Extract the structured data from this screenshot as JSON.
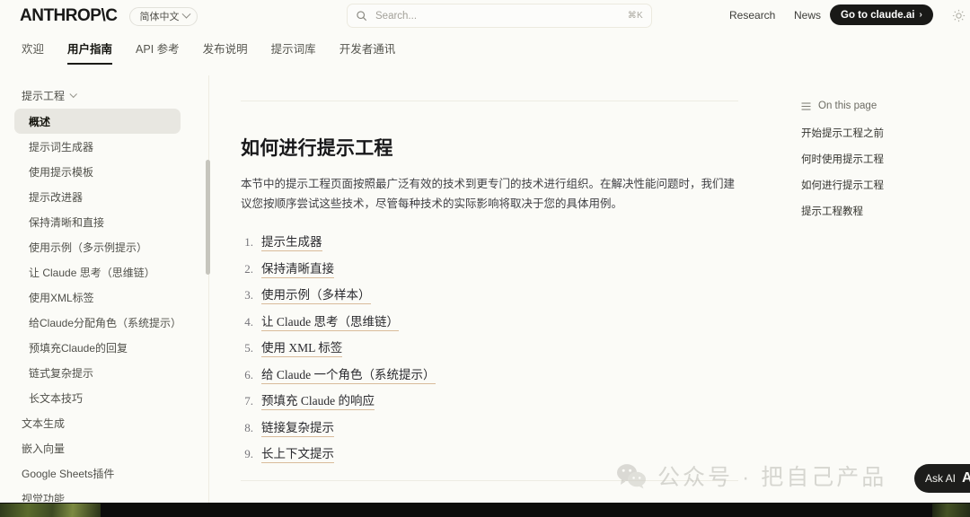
{
  "header": {
    "logo": "ANTHROP\\C",
    "language_selector": "简体中文",
    "search": {
      "placeholder": "Search...",
      "shortcut": "⌘K"
    },
    "links": [
      {
        "label": "Research"
      },
      {
        "label": "News"
      }
    ],
    "cta": {
      "label": "Go to claude.ai",
      "arrow": "›"
    }
  },
  "tabs": [
    {
      "label": "欢迎",
      "active": false
    },
    {
      "label": "用户指南",
      "active": true
    },
    {
      "label": "API 参考",
      "active": false
    },
    {
      "label": "发布说明",
      "active": false
    },
    {
      "label": "提示词库",
      "active": false
    },
    {
      "label": "开发者通讯",
      "active": false
    }
  ],
  "sidebar": {
    "group_label": "提示工程",
    "items": [
      {
        "label": "概述",
        "active": true,
        "level": "sub"
      },
      {
        "label": "提示词生成器",
        "active": false,
        "level": "sub"
      },
      {
        "label": "使用提示模板",
        "active": false,
        "level": "sub"
      },
      {
        "label": "提示改进器",
        "active": false,
        "level": "sub"
      },
      {
        "label": "保持清晰和直接",
        "active": false,
        "level": "sub"
      },
      {
        "label": "使用示例（多示例提示）",
        "active": false,
        "level": "sub"
      },
      {
        "label": "让 Claude 思考（思维链）",
        "active": false,
        "level": "sub"
      },
      {
        "label": "使用XML标签",
        "active": false,
        "level": "sub"
      },
      {
        "label": "给Claude分配角色（系统提示）",
        "active": false,
        "level": "sub"
      },
      {
        "label": "预填充Claude的回复",
        "active": false,
        "level": "sub"
      },
      {
        "label": "链式复杂提示",
        "active": false,
        "level": "sub"
      },
      {
        "label": "长文本技巧",
        "active": false,
        "level": "sub"
      },
      {
        "label": "文本生成",
        "active": false,
        "level": "top"
      },
      {
        "label": "嵌入向量",
        "active": false,
        "level": "top"
      },
      {
        "label": "Google Sheets插件",
        "active": false,
        "level": "top"
      },
      {
        "label": "视觉功能",
        "active": false,
        "level": "top"
      }
    ]
  },
  "main": {
    "heading": "如何进行提示工程",
    "paragraph": "本节中的提示工程页面按照最广泛有效的技术到更专门的技术进行组织。在解决性能问题时，我们建议您按顺序尝试这些技术，尽管每种技术的实际影响将取决于您的具体用例。",
    "list": [
      {
        "num": "1.",
        "label": "提示生成器"
      },
      {
        "num": "2.",
        "label": "保持清晰直接"
      },
      {
        "num": "3.",
        "label": "使用示例（多样本）"
      },
      {
        "num": "4.",
        "label": "让 Claude 思考（思维链）"
      },
      {
        "num": "5.",
        "label": "使用 XML 标签"
      },
      {
        "num": "6.",
        "label": "给 Claude 一个角色（系统提示）"
      },
      {
        "num": "7.",
        "label": "预填充 Claude 的响应"
      },
      {
        "num": "8.",
        "label": "链接复杂提示"
      },
      {
        "num": "9.",
        "label": "长上下文提示"
      }
    ]
  },
  "toc": {
    "title": "On this page",
    "links": [
      {
        "label": "开始提示工程之前"
      },
      {
        "label": "何时使用提示工程"
      },
      {
        "label": "如何进行提示工程"
      },
      {
        "label": "提示工程教程"
      }
    ]
  },
  "watermark": {
    "text": "公众号 · 把自己产品"
  },
  "ask_ai": {
    "label": "Ask AI",
    "badge": "A"
  },
  "colors": {
    "page_bg": "#fbfbf7",
    "text_primary": "#18181a",
    "text_muted": "#6d6c64",
    "accent_dark": "#191917",
    "link_underline": "#d9bb9a",
    "sidebar_active_bg": "#e8e7e1"
  }
}
